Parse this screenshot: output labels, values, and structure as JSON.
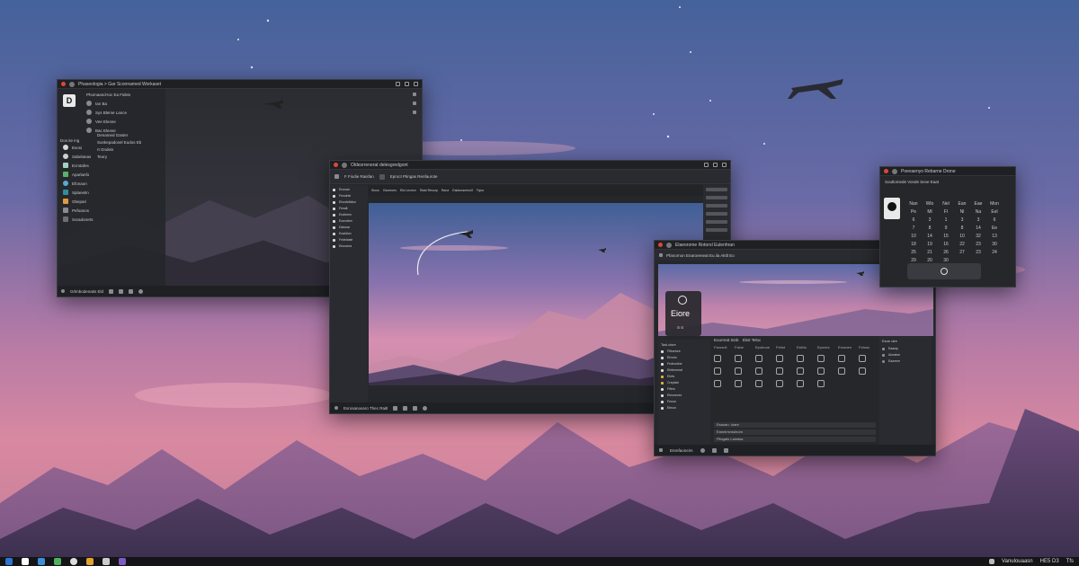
{
  "desktop": {
    "accent": "#e0453a",
    "airplane_icon": "airplane-icon"
  },
  "window_a": {
    "title": "Phaseologia > Gar Sconnamed Workaset",
    "logo_letter": "D",
    "header": "Phomaand-toc Ea Fideis",
    "tiles": [
      "Ian Ba",
      "Sys Bleme Lance",
      "Vee Eleose",
      "Bac Eleose"
    ],
    "group_label": "Denamed Gaster",
    "group_items": [
      "Sunkepadovel Eudos Eb",
      "rt  Gndeis",
      "Teory"
    ],
    "section_label": "Dos ite ing",
    "apps": [
      "Esosi",
      "Sabelanas",
      "Ecrstafes",
      "Aparlanfo",
      "Efonaon",
      "Splanetin",
      "Obepari",
      "Pefoanos",
      "Soradorerts"
    ],
    "status": "Grlmbodenatis Eld"
  },
  "window_b": {
    "title": "Oldesrrenerat delesgredgont",
    "app_label": "F Fiodie Raisfan",
    "tab_label": "Eproct Ptingas Renfaurote",
    "menu": [
      "Sloos",
      "Osoreoes",
      "Efa Lecrion",
      "Rlast Resorp",
      "Rana",
      "Eaidonanenolf",
      "Flyus"
    ],
    "sidebar": [
      "Enosan",
      "Fesolnte",
      "Ehosfelldion",
      "Fesalt",
      "Endteren",
      "Eonrofern",
      "Dalsnar",
      "Eoaldion",
      "Fedelaste",
      "Ebosrera"
    ],
    "status": "Esrosanovaro Thec Raitt"
  },
  "window_c": {
    "title": "Elaeorome Rotorol Eulenhran",
    "address": "Pfanornon Enaroreneat Eu.ila Aktlt Eo",
    "hero_title": "Eiore",
    "hero_sub": "a a",
    "pane_title": "Eoornrat Sinb",
    "pane_title2": "Ebst Teloo",
    "left_header": "Tasl.clsre",
    "columns": [
      "Farosnit",
      "Faloe",
      "Epobone",
      "Fetiot",
      "Esiblo",
      "Epones",
      "Eroanen",
      "Fetoss"
    ],
    "files": [
      "Ffitoetore",
      "Elvorio",
      "Fedeuldne",
      "Eleterneral",
      "Ebrts",
      "Crepiste",
      "Fifers",
      "Eleoneves",
      "Fenoe",
      "Eteoor"
    ],
    "list": [
      "Esaoan. Ioare",
      "Eannlrnvnulnom",
      "Pilogalo Lanstsa"
    ],
    "right_header": "Esoe olre",
    "right_items": [
      "Eaaslp",
      "Aloratoe",
      "Eaoeme"
    ],
    "status": "Enrefaoneirs"
  },
  "window_d": {
    "title": "Poevaenyo Rebarne Drone",
    "header": "Soutlomede Vonde Seve Eaat",
    "calendar": [
      "Nan",
      "Wlo",
      "Nel",
      "Ean",
      "Eae",
      "Mon",
      "Pe",
      "Ml",
      "Fl",
      "Nl",
      "Na",
      "Eel",
      "6",
      "3",
      "1",
      "3",
      "3",
      "6",
      "7",
      "8",
      "9",
      "8",
      "14",
      "Ee",
      "10",
      "14",
      "15",
      "10",
      "32",
      "13",
      "18",
      "19",
      "16",
      "22",
      "23",
      "30",
      "25",
      "21",
      "26",
      "27",
      "23",
      "24",
      "29",
      "20",
      "30",
      "",
      "",
      ""
    ]
  },
  "taskbar": {
    "tray_text": "Vanulouaasn",
    "clock": "HE5 D3",
    "lang": "Tfs"
  }
}
